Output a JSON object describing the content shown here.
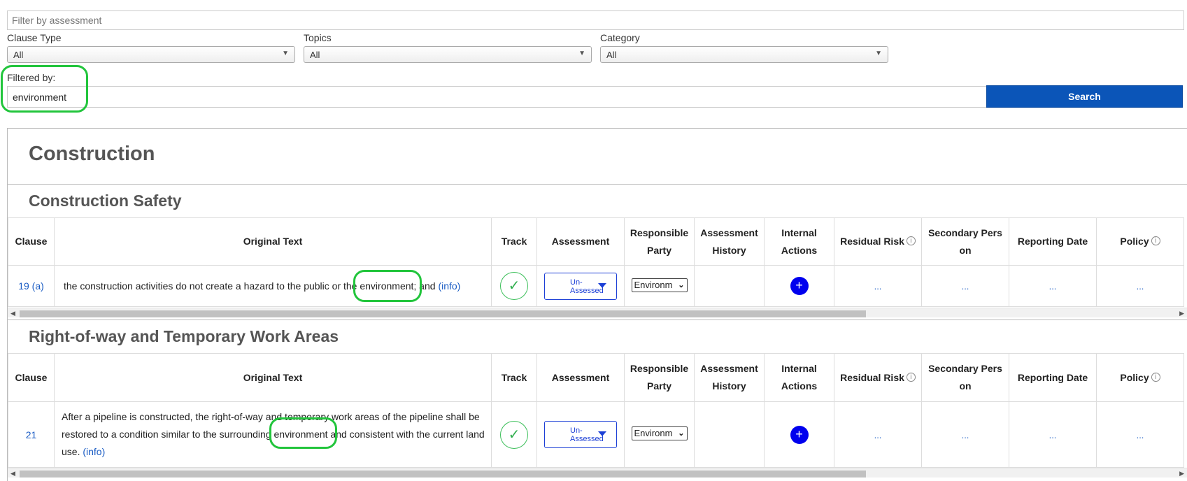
{
  "filters": {
    "assessment_placeholder": "Filter by assessment",
    "clause_type": {
      "label": "Clause Type",
      "value": "All"
    },
    "topics": {
      "label": "Topics",
      "value": "All"
    },
    "category": {
      "label": "Category",
      "value": "All"
    },
    "filtered_by_label": "Filtered by:",
    "filtered_by_value": "environment",
    "search_label": "Search"
  },
  "page_title": "Construction",
  "columns": {
    "clause": "Clause",
    "original_text": "Original Text",
    "track": "Track",
    "assessment": "Assessment",
    "responsible_party_1": "Responsible",
    "responsible_party_2": "Party",
    "assessment_history_1": "Assessment",
    "assessment_history_2": "History",
    "internal_actions_1": "Internal",
    "internal_actions_2": "Actions",
    "residual_risk": "Residual Risk",
    "secondary_person_1": "Secondary Pers",
    "secondary_person_2": "on",
    "reporting_date": "Reporting Date",
    "policy": "Policy"
  },
  "sections": [
    {
      "title": "Construction Safety",
      "row": {
        "clause": "19 (a)",
        "text_before": "the construction activities do not create a hazard to the public or the ",
        "text_highlight": "environment",
        "text_after": "; and ",
        "info_link": "(info)",
        "track_icon": "check-icon",
        "assessment_line1": "Un-",
        "assessment_line2": "Assessed",
        "responsible": "Environm",
        "residual_risk": "...",
        "secondary_person": "...",
        "reporting_date": "...",
        "policy": "..."
      }
    },
    {
      "title": "Right-of-way and Temporary Work Areas",
      "row": {
        "clause": "21",
        "text_before": "After a pipeline is constructed, the right-of-way and temporary work areas of the pipeline shall be restored to a condition similar to the surrounding ",
        "text_highlight": "environment",
        "text_after": " and consistent with the current land use. ",
        "info_link": "(info)",
        "track_icon": "check-icon",
        "assessment_line1": "Un-",
        "assessment_line2": "Assessed",
        "responsible": "Environm",
        "residual_risk": "...",
        "secondary_person": "...",
        "reporting_date": "...",
        "policy": "..."
      }
    }
  ],
  "colors": {
    "search_button": "#0b55b8",
    "highlight_ring": "#22c53c",
    "link": "#1a5cc4",
    "plus_button": "#0000ee"
  }
}
